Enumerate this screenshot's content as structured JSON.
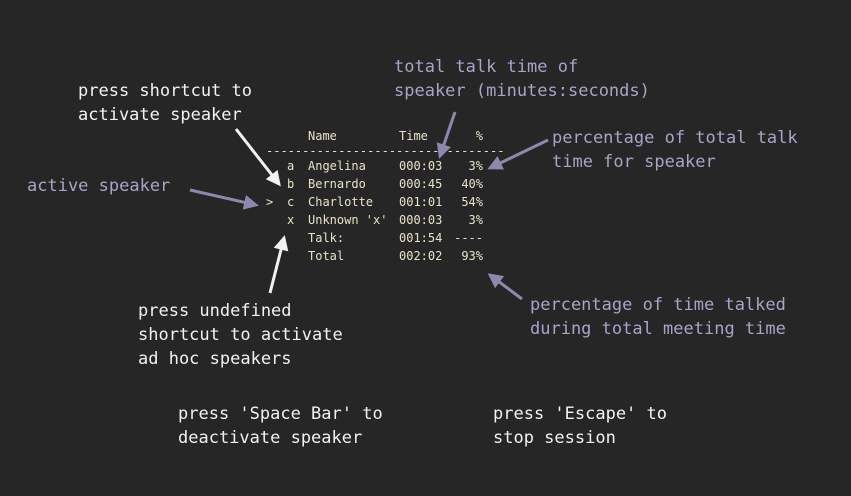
{
  "annotations": {
    "press_shortcut": "press shortcut to\nactivate speaker",
    "total_talk_time": "total talk time of\nspeaker (minutes:seconds)",
    "percentage_total": "percentage of total talk\ntime for speaker",
    "active_speaker": "active speaker",
    "press_undefined": "press undefined\nshortcut to activate\nad hoc speakers",
    "percentage_meeting": "percentage of time talked\nduring total meeting time",
    "press_space": "press 'Space Bar' to\ndeactivate speaker",
    "press_escape": "press 'Escape' to\nstop session"
  },
  "table": {
    "headers": {
      "name": "Name",
      "time": "Time",
      "pct": "%"
    },
    "rule": "---------------------------------",
    "rows": [
      {
        "marker": "",
        "key": "a",
        "name": "Angelina",
        "time": "000:03",
        "pct": "3%"
      },
      {
        "marker": "",
        "key": "b",
        "name": "Bernardo",
        "time": "000:45",
        "pct": "40%"
      },
      {
        "marker": ">",
        "key": "c",
        "name": "Charlotte",
        "time": "001:01",
        "pct": "54%"
      },
      {
        "marker": "",
        "key": "x",
        "name": "Unknown 'x'",
        "time": "000:03",
        "pct": "3%"
      },
      {
        "marker": "",
        "key": "",
        "name": "Talk:",
        "time": "001:54",
        "pct": "----"
      },
      {
        "marker": "",
        "key": "",
        "name": "Total",
        "time": "002:02",
        "pct": "93%"
      }
    ]
  },
  "colors": {
    "background": "#262626",
    "white_text": "#f2f2f2",
    "lavender_text": "#a8a4c8",
    "terminal_text": "#e9e3c8"
  }
}
